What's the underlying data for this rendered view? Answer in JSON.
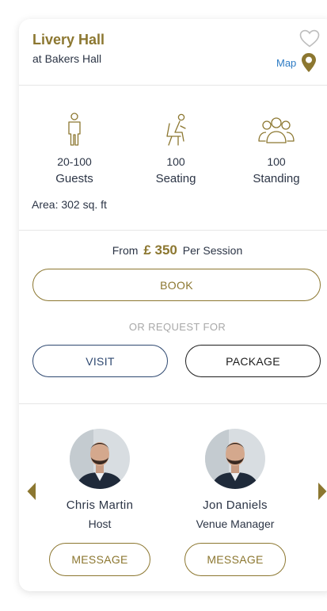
{
  "venue": {
    "title": "Livery Hall",
    "subtitle": "at Bakers Hall",
    "map_label": "Map"
  },
  "capacity": {
    "guests": {
      "value": "20-100",
      "label": "Guests"
    },
    "seating": {
      "value": "100",
      "label": "Seating"
    },
    "standing": {
      "value": "100",
      "label": "Standing"
    },
    "area": "Area: 302 sq. ft"
  },
  "pricing": {
    "from": "From",
    "amount": "£ 350",
    "per": "Per Session",
    "book_label": "BOOK",
    "or_request": "OR REQUEST FOR",
    "visit_label": "VISIT",
    "package_label": "PACKAGE"
  },
  "contacts": [
    {
      "name": "Chris Martin",
      "role": "Host",
      "button": "MESSAGE"
    },
    {
      "name": "Jon Daniels",
      "role": "Venue Manager",
      "button": "MESSAGE"
    }
  ],
  "colors": {
    "accent_gold": "#8c7730",
    "link_blue": "#2d7bc4",
    "navy": "#2e4870"
  },
  "icons": {
    "favorite": "heart-icon",
    "map": "map-pin-icon",
    "guests": "person-icon",
    "seating": "seat-icon",
    "standing": "group-icon",
    "prev": "chevron-left-icon",
    "next": "chevron-right-icon"
  }
}
